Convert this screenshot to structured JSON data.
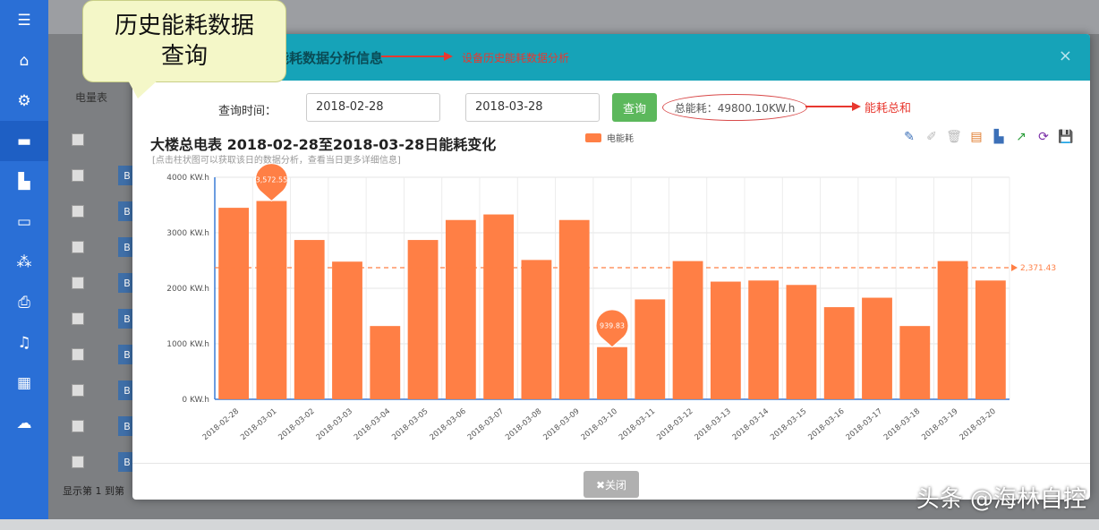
{
  "callout": {
    "line1": "历史能耗数据",
    "line2": "查询"
  },
  "sidebar": {
    "icons": [
      "menu-icon",
      "home-icon",
      "gear-icon",
      "list-icon",
      "bar-chart-icon",
      "card-icon",
      "org-chart-icon",
      "print-icon",
      "bell-icon",
      "grid-icon",
      "cloud-upload-icon"
    ]
  },
  "background": {
    "tab_label": "电量表",
    "page_info": "显示第 1 到第"
  },
  "modal": {
    "title": "能耗数据分析信息",
    "header_note": "设备历史能耗数据分析",
    "query_label": "查询时间：",
    "start_date": "2018-02-28",
    "end_date": "2018-03-28",
    "query_button": "查询",
    "total": "总能耗：49800.10KW.h",
    "total_note": "能耗总和",
    "close_button": "✖关闭"
  },
  "chart_data": {
    "type": "bar",
    "title": "大楼总电表 2018-02-28至2018-03-28日能耗变化",
    "subtitle": "[点击柱状图可以获取该日的数据分析，查看当日更多详细信息]",
    "legend": [
      "电能耗"
    ],
    "series": [
      {
        "name": "电能耗",
        "color": "#ff7f45",
        "values": [
          3450,
          3572.55,
          2870,
          2480,
          1320,
          2870,
          3230,
          3330,
          2510,
          3230,
          939.83,
          1800,
          2490,
          2120,
          2140,
          2060,
          1660,
          1830,
          1320,
          2490,
          2140
        ]
      }
    ],
    "categories": [
      "2018-02-28",
      "2018-03-01",
      "2018-03-02",
      "2018-03-03",
      "2018-03-04",
      "2018-03-05",
      "2018-03-06",
      "2018-03-07",
      "2018-03-08",
      "2018-03-09",
      "2018-03-10",
      "2018-03-11",
      "2018-03-12",
      "2018-03-13",
      "2018-03-14",
      "2018-03-15",
      "2018-03-16",
      "2018-03-17",
      "2018-03-18",
      "2018-03-19",
      "2018-03-20"
    ],
    "ylim": [
      0,
      4000
    ],
    "yticks": [
      "0 KW.h",
      "1000 KW.h",
      "2000 KW.h",
      "3000 KW.h",
      "4000 KW.h"
    ],
    "max_label": "3,572.55",
    "min_label": "939.83",
    "average": 2371.43,
    "average_label": "2,371.43",
    "grid": true
  },
  "watermark": "头条 @海林自控"
}
